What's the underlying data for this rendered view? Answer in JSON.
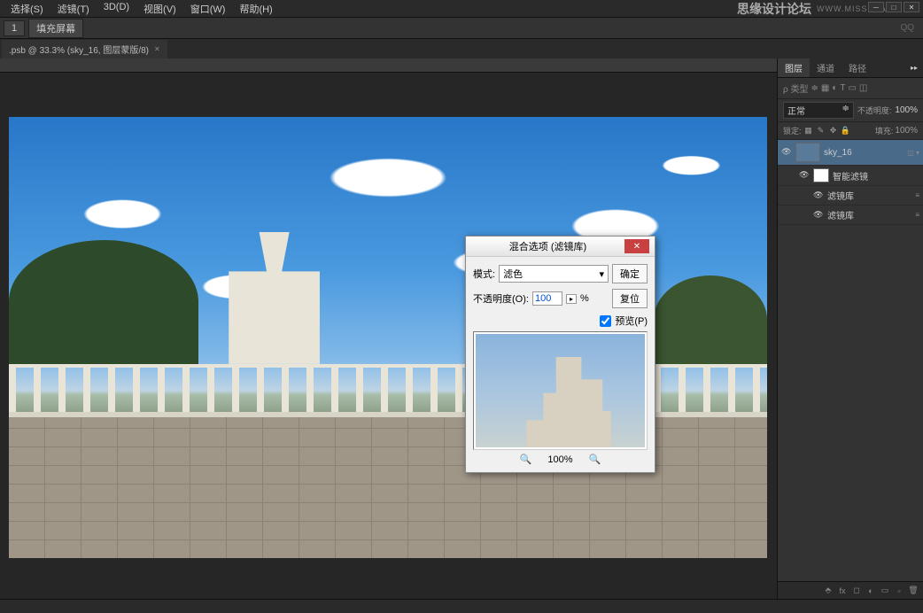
{
  "menu": {
    "items": [
      "选择(S)",
      "滤镜(T)",
      "3D(D)",
      "视图(V)",
      "窗口(W)",
      "帮助(H)"
    ]
  },
  "brand": {
    "name": "思缘设计论坛",
    "url": "WWW.MISSYUAN.COM"
  },
  "ribbon": {
    "btn1": "1",
    "btn2": "填充屏幕",
    "qq": "QQ"
  },
  "doc_tab": {
    "label": ".psb @ 33.3% (sky_16, 图层蒙版/8)"
  },
  "dialog": {
    "title": "混合选项 (滤镜库)",
    "mode_label": "模式:",
    "mode_value": "滤色",
    "ok": "确定",
    "opacity_label": "不透明度(O):",
    "opacity_value": "100",
    "opacity_unit": "%",
    "reset": "复位",
    "preview_check": "预览(P)",
    "zoom_value": "100%"
  },
  "panel": {
    "tabs": [
      "图层",
      "通道",
      "路径"
    ],
    "kind_label": "ρ 类型",
    "blend_mode": "正常",
    "opacity_label": "不透明度:",
    "opacity_value": "100%",
    "lock_label": "锁定:",
    "fill_label": "填充:",
    "fill_value": "100%"
  },
  "layers": [
    {
      "name": "sky_16",
      "selected": true
    },
    {
      "name": "智能滤镜",
      "sub": 1
    },
    {
      "name": "滤镜库",
      "sub": 2
    },
    {
      "name": "滤镜库",
      "sub": 2
    }
  ]
}
